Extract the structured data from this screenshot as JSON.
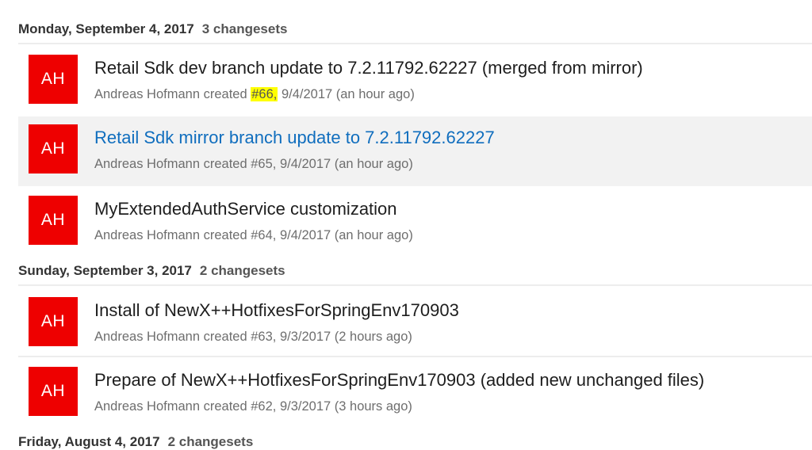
{
  "groups": [
    {
      "date": "Monday, September 4, 2017",
      "count": "3 changesets",
      "items": [
        {
          "avatar": "AH",
          "title": "Retail Sdk dev branch update to 7.2.11792.62227 (merged from mirror)",
          "author": "Andreas Hofmann",
          "verb": "created",
          "id": "#66,",
          "date": "9/4/2017 (an hour ago)"
        },
        {
          "avatar": "AH",
          "title": "Retail Sdk mirror branch update to 7.2.11792.62227",
          "author": "Andreas Hofmann",
          "verb": "created",
          "id": "#65,",
          "date": "9/4/2017 (an hour ago)"
        },
        {
          "avatar": "AH",
          "title": "MyExtendedAuthService customization",
          "author": "Andreas Hofmann",
          "verb": "created",
          "id": "#64,",
          "date": "9/4/2017 (an hour ago)"
        }
      ]
    },
    {
      "date": "Sunday, September 3, 2017",
      "count": "2 changesets",
      "items": [
        {
          "avatar": "AH",
          "title": "Install of NewX++HotfixesForSpringEnv170903",
          "author": "Andreas Hofmann",
          "verb": "created",
          "id": "#63,",
          "date": "9/3/2017 (2 hours ago)"
        },
        {
          "avatar": "AH",
          "title": "Prepare of NewX++HotfixesForSpringEnv170903 (added new unchanged files)",
          "author": "Andreas Hofmann",
          "verb": "created",
          "id": "#62,",
          "date": "9/3/2017 (3 hours ago)"
        }
      ]
    },
    {
      "date": "Friday, August 4, 2017",
      "count": "2 changesets",
      "items": []
    }
  ],
  "colors": {
    "avatar_bg": "#ee0000",
    "link": "#106ebe",
    "highlight": "#ffff00",
    "selected_row": "#f2f2f2"
  }
}
